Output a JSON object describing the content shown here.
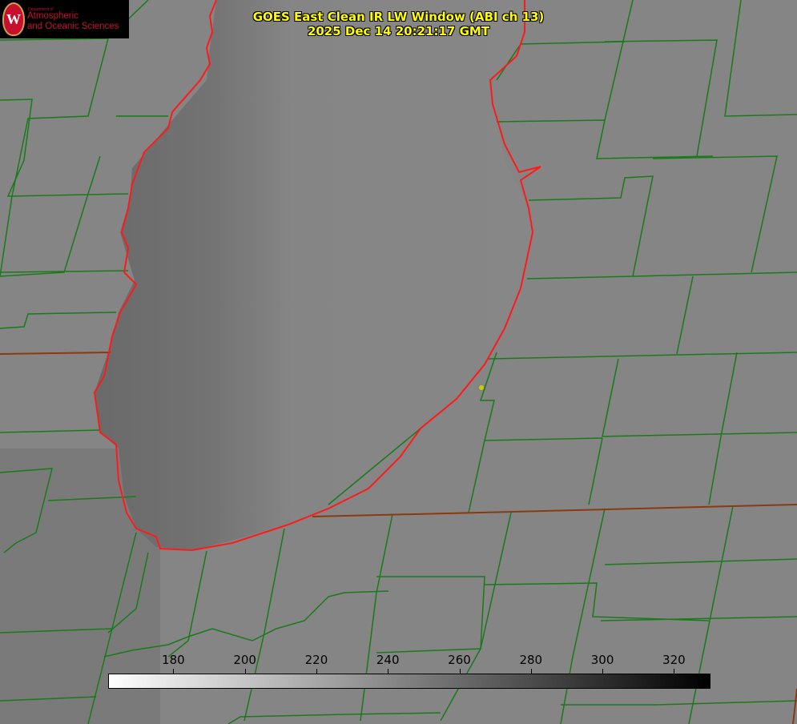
{
  "title": {
    "line1": "GOES East Clean IR LW Window (ABI ch 13)",
    "line2": "2025 Dec 14 20:21:17 GMT"
  },
  "logo": {
    "crest_letter": "W",
    "department": "Department of",
    "line1": "Atmospheric",
    "line2": "and Oceanic Sciences"
  },
  "colorbar": {
    "range": [
      162,
      330
    ],
    "colors": [
      "#ffffff",
      "#000000"
    ],
    "ticks": [
      "180",
      "200",
      "220",
      "240",
      "260",
      "280",
      "300",
      "320"
    ]
  },
  "colors": {
    "county_lines": "#1a7a1a",
    "lake_outline": "#ff1a1a",
    "title": "#ffff00"
  }
}
